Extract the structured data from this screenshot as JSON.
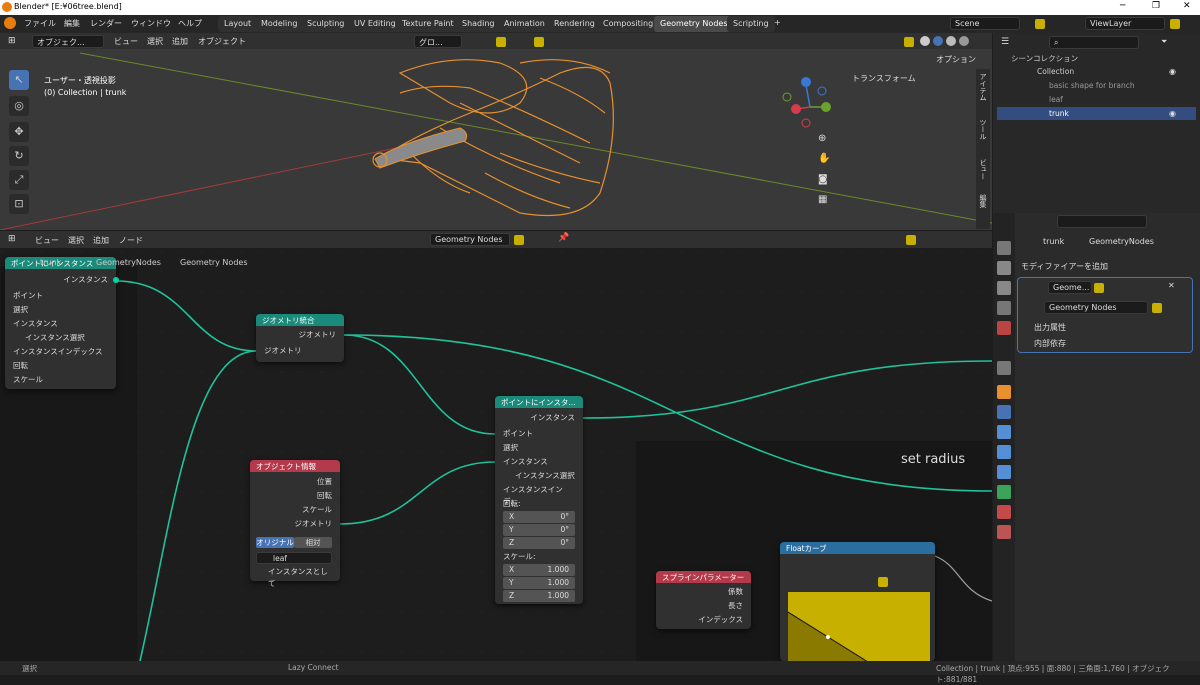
{
  "titlebar": {
    "title": "Blender* [E:¥06tree.blend]",
    "min": "─",
    "max": "❐",
    "close": "✕"
  },
  "menu": [
    "ファイル",
    "編集",
    "レンダー",
    "ウィンドウ",
    "ヘルプ"
  ],
  "workspaces": [
    "Layout",
    "Modeling",
    "Sculpting",
    "UV Editing",
    "Texture Paint",
    "Shading",
    "Animation",
    "Rendering",
    "Compositing",
    "Geometry Nodes",
    "Scripting",
    "+"
  ],
  "active_workspace": "Geometry Nodes",
  "scene": "Scene",
  "viewlayer": "ViewLayer",
  "viewport": {
    "mode": "オブジェク...",
    "menus": [
      "ビュー",
      "選択",
      "追加",
      "オブジェクト"
    ],
    "orientation": "グロ...",
    "view_label": "ユーザー・透視投影",
    "collection_label": "(0) Collection | trunk",
    "options": "オプション",
    "transform_tab": "トランスフォーム",
    "side_tabs": [
      "アイテム",
      "ツール",
      "ビュー",
      "編集"
    ]
  },
  "outliner": {
    "title": "シーンコレクション",
    "items": [
      "Collection",
      "basic shape for branch",
      "leaf",
      "trunk"
    ]
  },
  "node_editor": {
    "menus": [
      "ビュー",
      "選択",
      "追加",
      "ノード"
    ],
    "tree_name": "Geometry Nodes",
    "breadcrumb": [
      "trunk",
      "GeometryNodes",
      "Geometry Nodes"
    ],
    "frame_label": "set radius"
  },
  "nodes": {
    "n1": {
      "title": "ポイントにインスタンス",
      "out": "インスタンス",
      "inputs": [
        "ポイント",
        "選択",
        "インスタンス",
        "インスタンス選択",
        "インスタンスインデックス",
        "回転",
        "スケール"
      ]
    },
    "join": {
      "title": "ジオメトリ統合",
      "out": "ジオメトリ",
      "in": "ジオメトリ"
    },
    "objinfo": {
      "title": "オブジェクト情報",
      "outs": [
        "位置",
        "回転",
        "スケール",
        "ジオメトリ"
      ],
      "modes": [
        "オリジナル",
        "相対"
      ],
      "object": "leaf",
      "as_instance": "インスタンスとして"
    },
    "n2": {
      "title": "ポイントにインスタ...",
      "out": "インスタンス",
      "inputs": [
        "ポイント",
        "選択",
        "インスタンス",
        "インスタンス選択",
        "インスタンスインデ..."
      ],
      "rot_label": "回転:",
      "rot": [
        {
          "axis": "X",
          "val": "0°"
        },
        {
          "axis": "Y",
          "val": "0°"
        },
        {
          "axis": "Z",
          "val": "0°"
        }
      ],
      "scale_label": "スケール:",
      "scale": [
        {
          "axis": "X",
          "val": "1.000"
        },
        {
          "axis": "Y",
          "val": "1.000"
        },
        {
          "axis": "Z",
          "val": "1.000"
        }
      ]
    },
    "spline": {
      "title": "スプラインパラメーター",
      "outs": [
        "係数",
        "長さ",
        "インデックス"
      ]
    },
    "curve": {
      "title": "Floatカーブ"
    }
  },
  "props": {
    "breadcrumb": [
      "trunk",
      "GeometryNodes"
    ],
    "add_modifier": "モディファイアーを追加",
    "modifier_name": "Geome...",
    "tree": "Geometry Nodes",
    "panels": [
      "出力属性",
      "内部依存"
    ]
  },
  "status": {
    "left": "選択",
    "mid": "Lazy Connect",
    "right": "Collection | trunk | 頂点:955 | 面:880 | 三角面:1,760 | オブジェクト:881/881"
  },
  "colors": {
    "accent": "#4772b3",
    "teal_header": "#1a8a7a",
    "geo_socket": "#00d6a3",
    "wire": "#1fc29a",
    "object_orange": "#e8902e",
    "yellow_curve": "#c8b000"
  }
}
